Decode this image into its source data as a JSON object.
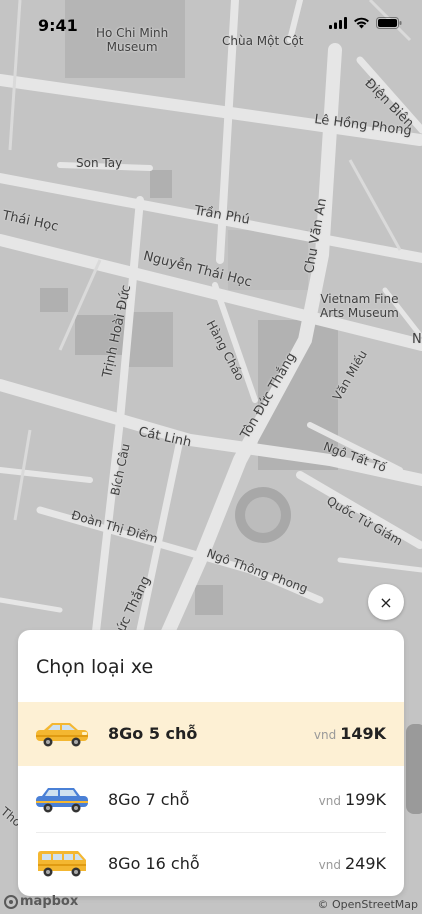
{
  "status_bar": {
    "time": "9:41"
  },
  "map": {
    "labels": {
      "ho_chi_minh_museum_1": "Ho Chi Minh",
      "ho_chi_minh_museum_2": "Museum",
      "chua_mot_cot": "Chùa Một Cột",
      "dien_bien": "Điện Biên",
      "le_hong_phong": "Lê Hồng Phong",
      "son_tay": "Son Tay",
      "tran_phu": "Trần Phú",
      "thai_hoc": "Thái Học",
      "chu_van_an": "Chu Văn An",
      "nguyen_thai_hoc": "Nguyễn Thái Học",
      "vietnam_fine_arts_1": "Vietnam Fine",
      "vietnam_fine_arts_2": "Arts Museum",
      "trinh_hoai_duc": "Trịnh Hoài Đức",
      "hang_chao": "Hàng Cháo",
      "ton_duc_thang": "Tôn Đức Thắng",
      "van_mieu": "Văn Miếu",
      "cat_linh": "Cát Linh",
      "ngo_tat_to": "Ngô Tất Tố",
      "bich_cau": "Bích Câu",
      "quoc_tu_giam": "Quốc Tử Giám",
      "doan_thi_diem": "Đoàn Thị Điểm",
      "ngo_thong_phong": "Ngô Thông Phong",
      "duc_thang": "ức Thắng",
      "tho": "Thổ",
      "n_edge": "N"
    }
  },
  "close_button": {
    "symbol": "×"
  },
  "sheet": {
    "title": "Chọn loại xe",
    "vehicles": [
      {
        "name": "8Go 5 chỗ",
        "currency": "vnd",
        "price": "149K",
        "selected": true
      },
      {
        "name": "8Go 7 chỗ",
        "currency": "vnd",
        "price": "199K",
        "selected": false
      },
      {
        "name": "8Go 16 chỗ",
        "currency": "vnd",
        "price": "249K",
        "selected": false
      }
    ]
  },
  "footer": {
    "mapbox": "mapbox",
    "attribution": "© OpenStreetMap"
  },
  "colors": {
    "selected_row": "#fdf0d4",
    "car_yellow": "#f4b731",
    "car_blue": "#4a80d6",
    "map_bg": "#c4c4c4",
    "road": "#e6e6e6"
  }
}
